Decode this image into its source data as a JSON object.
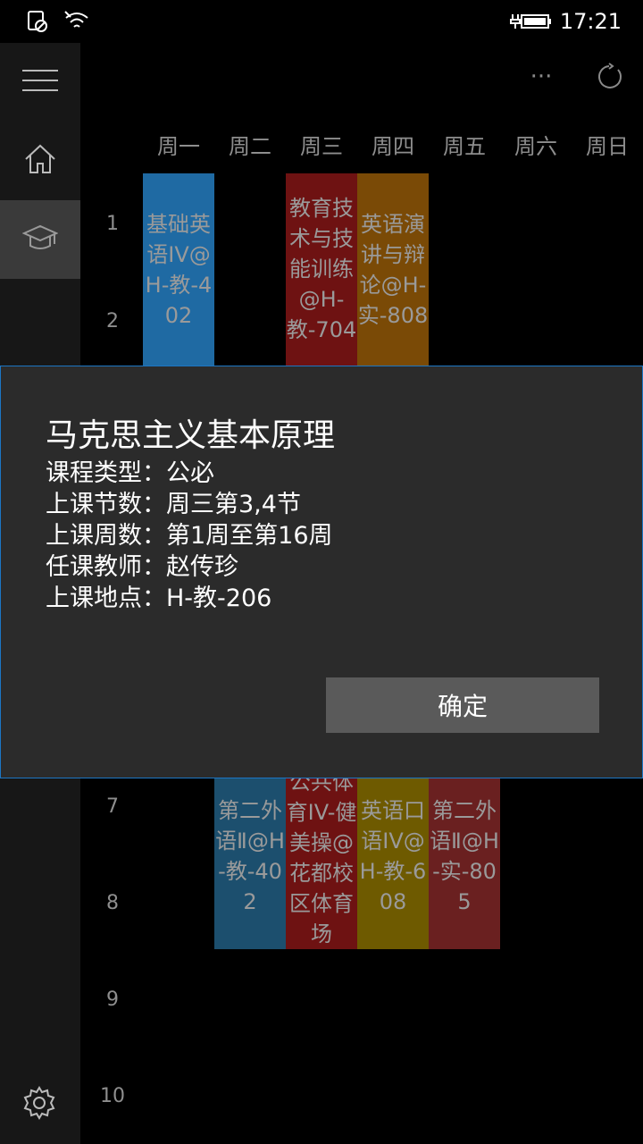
{
  "status_bar": {
    "time": "17:21"
  },
  "days": [
    "周一",
    "周二",
    "周三",
    "周四",
    "周五",
    "周六",
    "周日"
  ],
  "periods": [
    "1",
    "2",
    "7",
    "8",
    "9",
    "10"
  ],
  "courses": [
    {
      "text": "基础英语IV@H-教-402"
    },
    {
      "text": "教育技术与技能训练@H-教-704"
    },
    {
      "text": "英语演讲与辩论@H-实-808"
    },
    {
      "text": "第二外语Ⅱ@H-教-402"
    },
    {
      "text": "公共体育IV-健美操@花都校区体育场"
    },
    {
      "text": "英语口语IV@H-教-608"
    },
    {
      "text": "第二外语Ⅱ@H-实-805"
    }
  ],
  "dialog": {
    "title": "马克思主义基本原理",
    "lines": [
      "课程类型：公必",
      "上课节数：周三第3,4节",
      "上课周数：第1周至第16周",
      "任课教师：赵传珍",
      "上课地点：H-教-206"
    ],
    "ok_label": "确定"
  },
  "icons": {
    "status": [
      "no-sim-icon",
      "wifi-icon",
      "battery-charging-icon"
    ],
    "sidebar": [
      "hamburger-menu-icon",
      "home-icon",
      "graduation-cap-icon",
      "settings-gear-icon"
    ],
    "command": [
      "more-ellipsis-icon",
      "refresh-icon"
    ]
  },
  "colors": {
    "accent": "#1c76c4"
  }
}
